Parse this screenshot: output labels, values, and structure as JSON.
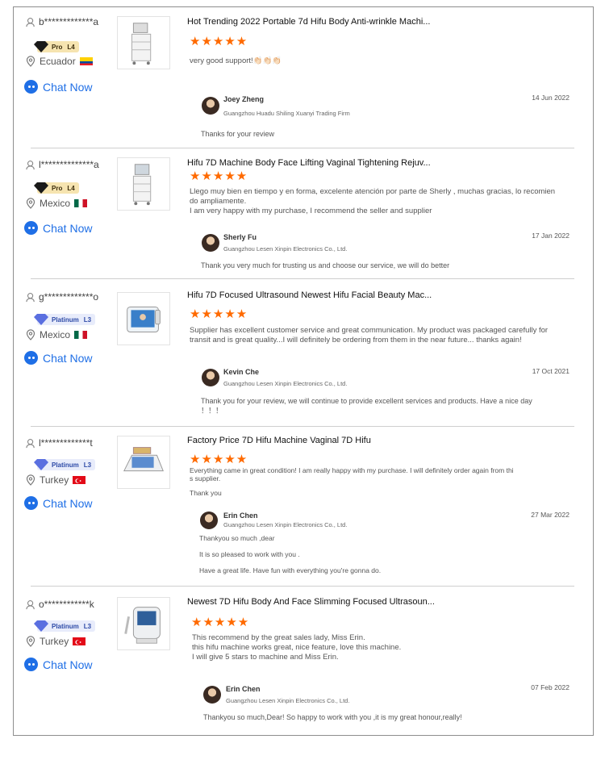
{
  "reviews": [
    {
      "buyer": "b*************a",
      "badge_tier": "Pro",
      "badge_level": "L4",
      "country": "Ecuador",
      "chat_label": "Chat Now",
      "product_title": "Hot Trending 2022 Portable 7d Hifu Body Anti-wrinkle Machi...",
      "stars": "★★★★★",
      "review_lines": [
        "very good support!👏🏻👏🏻👏🏻"
      ],
      "seller_name": "Joey Zheng",
      "seller_firm": "Guangzhou Huadu Shiling Xuanyi Trading Firm",
      "reply_date": "14 Jun 2022",
      "reply_lines": [
        "Thanks for your review"
      ]
    },
    {
      "buyer": "l**************a",
      "badge_tier": "Pro",
      "badge_level": "L4",
      "country": "Mexico",
      "chat_label": "Chat Now",
      "product_title": "Hifu 7D Machine Body Face Lifting Vaginal Tightening Rejuv...",
      "stars": "★★★★★",
      "review_lines": [
        "Llego muy bien en tiempo y en forma, excelente atención por parte de Sherly , muchas gracias, lo recomien",
        "do ampliamente.",
        "I am very happy with my purchase, I recommend the seller and supplier"
      ],
      "seller_name": "Sherly Fu",
      "seller_firm": "Guangzhou Lesen Xinpin Electronics Co., Ltd.",
      "reply_date": "17 Jan 2022",
      "reply_lines": [
        "Thank you very much for trusting us and choose our service, we will do better"
      ]
    },
    {
      "buyer": "g*************o",
      "badge_tier": "Platinum",
      "badge_level": "L3",
      "country": "Mexico",
      "chat_label": "Chat Now",
      "product_title": "Hifu 7D Focused Ultrasound Newest Hifu Facial Beauty Mac...",
      "stars": "★★★★★",
      "review_lines": [
        "Supplier has excellent customer service and great communication. My product was packaged carefully for",
        "transit and is great quality...I will definitely be ordering from them in the near future... thanks again!"
      ],
      "seller_name": "Kevin Che",
      "seller_firm": "Guangzhou Lesen Xinpin Electronics Co., Ltd.",
      "reply_date": "17 Oct 2021",
      "reply_lines": [
        "Thank you for your review, we will continue to provide excellent services and products. Have a nice day",
        "！！！"
      ]
    },
    {
      "buyer": "l*************t",
      "badge_tier": "Platinum",
      "badge_level": "L3",
      "country": "Turkey",
      "chat_label": "Chat Now",
      "product_title": "Factory Price 7D Hifu Machine Vaginal 7D Hifu",
      "stars": "★★★★★",
      "review_lines": [
        "Everything came in great condition! I am really happy with my purchase. I will definitely order again from thi",
        "s supplier.",
        "",
        "Thank you"
      ],
      "seller_name": "Erin Chen",
      "seller_firm": "Guangzhou Lesen Xinpin Electronics Co., Ltd.",
      "reply_date": "27 Mar 2022",
      "reply_lines": [
        "Thankyou so much ,dear",
        "",
        "It is so pleased to work with you .",
        "",
        "Have a great life. Have fun with everything you're gonna do."
      ]
    },
    {
      "buyer": "o************k",
      "badge_tier": "Platinum",
      "badge_level": "L3",
      "country": "Turkey",
      "chat_label": "Chat Now",
      "product_title": "Newest 7D Hifu Body And Face Slimming Focused Ultrasoun...",
      "stars": "★★★★★",
      "review_lines": [
        "This recommend by the great sales lady, Miss Erin.",
        "this hifu machine works great, nice feature, love this machine.",
        "I will give 5 stars to machine and Miss Erin."
      ],
      "seller_name": "Erin Chen",
      "seller_firm": "Guangzhou Lesen Xinpin Electronics Co., Ltd.",
      "reply_date": "07 Feb 2022",
      "reply_lines": [
        "Thankyou so much,Dear! So happy to work with you ,it is my great honour,really!"
      ]
    }
  ]
}
